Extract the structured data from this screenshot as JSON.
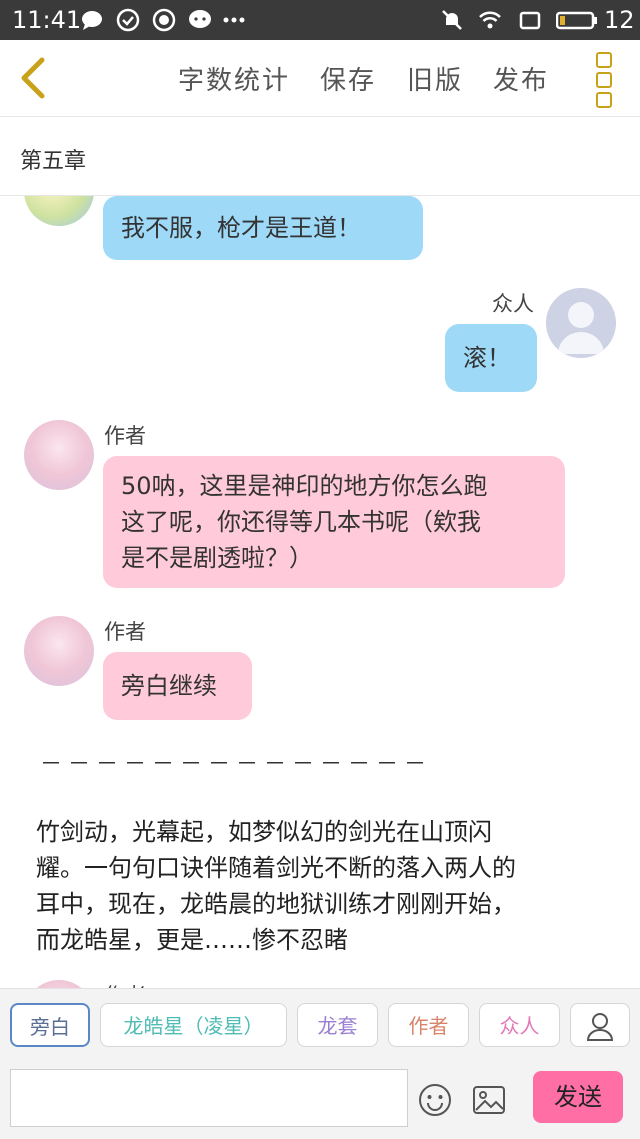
{
  "status_bar": {
    "time": "11:41",
    "battery_level": "12",
    "left_icons": [
      "chat-bubble-icon",
      "check-circle-icon",
      "xiu-badge-icon",
      "chat-dots-icon",
      "more-dots-icon"
    ],
    "right_icons": [
      "mute-icon",
      "wifi-icon",
      "screen-icon",
      "battery-icon"
    ]
  },
  "toolbar": {
    "back_icon": "chevron-left-icon",
    "word_count": "字数统计",
    "save": "保存",
    "old_version": "旧版",
    "publish": "发布",
    "menu_icon": "menu-dots-icon",
    "accent": "#c9a21c"
  },
  "chapter": {
    "title": "第五章"
  },
  "messages": [
    {
      "side": "left",
      "name": "",
      "text": "我不服，枪才是王道！",
      "color": "#9ed9f7"
    },
    {
      "side": "right",
      "name": "众人",
      "text": "滚！",
      "color": "#9ed9f7"
    },
    {
      "side": "left",
      "name": "作者",
      "text_lines": [
        "50呐，这里是神印的地方你怎么跑",
        "这了呢，你还得等几本书呢（欸我",
        "是不是剧透啦？）"
      ],
      "color": "#ffcad9"
    },
    {
      "side": "left",
      "name": "作者",
      "text": "旁白继续",
      "color": "#ffcad9"
    }
  ],
  "divider": "－－－－－－－－－－－－－－",
  "narration_lines": [
    "竹剑动，光幕起，如梦似幻的剑光在山顶闪",
    "耀。一句句口诀伴随着剑光不断的落入两人的",
    "耳中，现在，龙皓晨的地狱训练才刚刚开始，",
    "而龙皓星，更是……惨不忍睹"
  ],
  "partial_name": "作者",
  "role_chips": [
    {
      "label": "旁白",
      "color": "#5b6f95",
      "active": true
    },
    {
      "label": "龙皓星（凌星）",
      "color": "#4fbcb5",
      "active": false
    },
    {
      "label": "龙套",
      "color": "#9a7fd0",
      "active": false
    },
    {
      "label": "作者",
      "color": "#d9846a",
      "active": false
    },
    {
      "label": "众人",
      "color": "#e27ab8",
      "active": false
    }
  ],
  "input": {
    "value": "",
    "placeholder": ""
  },
  "send_label": "发送",
  "send_color": "#ff6fa6",
  "icons": {
    "add_role": "person-icon",
    "emoji": "smiley-icon",
    "image": "image-icon"
  }
}
